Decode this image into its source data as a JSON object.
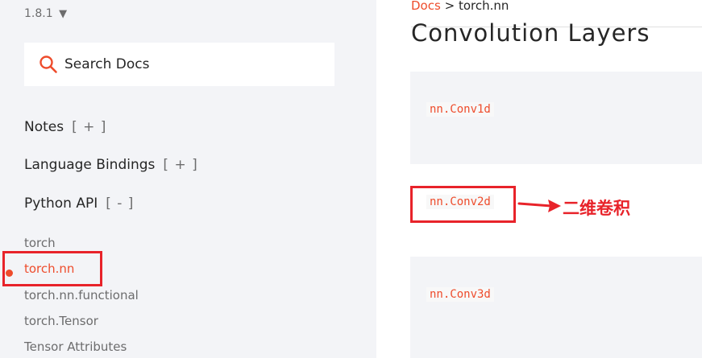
{
  "sidebar": {
    "version": "1.8.1",
    "version_caret": "▼",
    "search": {
      "placeholder": "Search Docs"
    },
    "sections": [
      {
        "label": "Notes",
        "toggle": "[ + ]"
      },
      {
        "label": "Language Bindings",
        "toggle": "[ + ]"
      },
      {
        "label": "Python API",
        "toggle": "[ - ]"
      }
    ],
    "items": [
      "torch",
      "torch.nn",
      "torch.nn.functional",
      "torch.Tensor",
      "Tensor Attributes"
    ],
    "active_item": "torch.nn"
  },
  "main": {
    "breadcrumb": {
      "root": "Docs",
      "separator": ">",
      "current": "torch.nn"
    },
    "title": "Convolution Layers",
    "modules": [
      "nn.Conv1d",
      "nn.Conv2d",
      "nn.Conv3d"
    ]
  },
  "annotation": {
    "text": "二维卷积",
    "color": "#e8232a"
  },
  "colors": {
    "accent": "#ee4c2c",
    "sidebar_bg": "#f3f4f7",
    "text": "#262626",
    "muted": "#6c6c6d"
  }
}
